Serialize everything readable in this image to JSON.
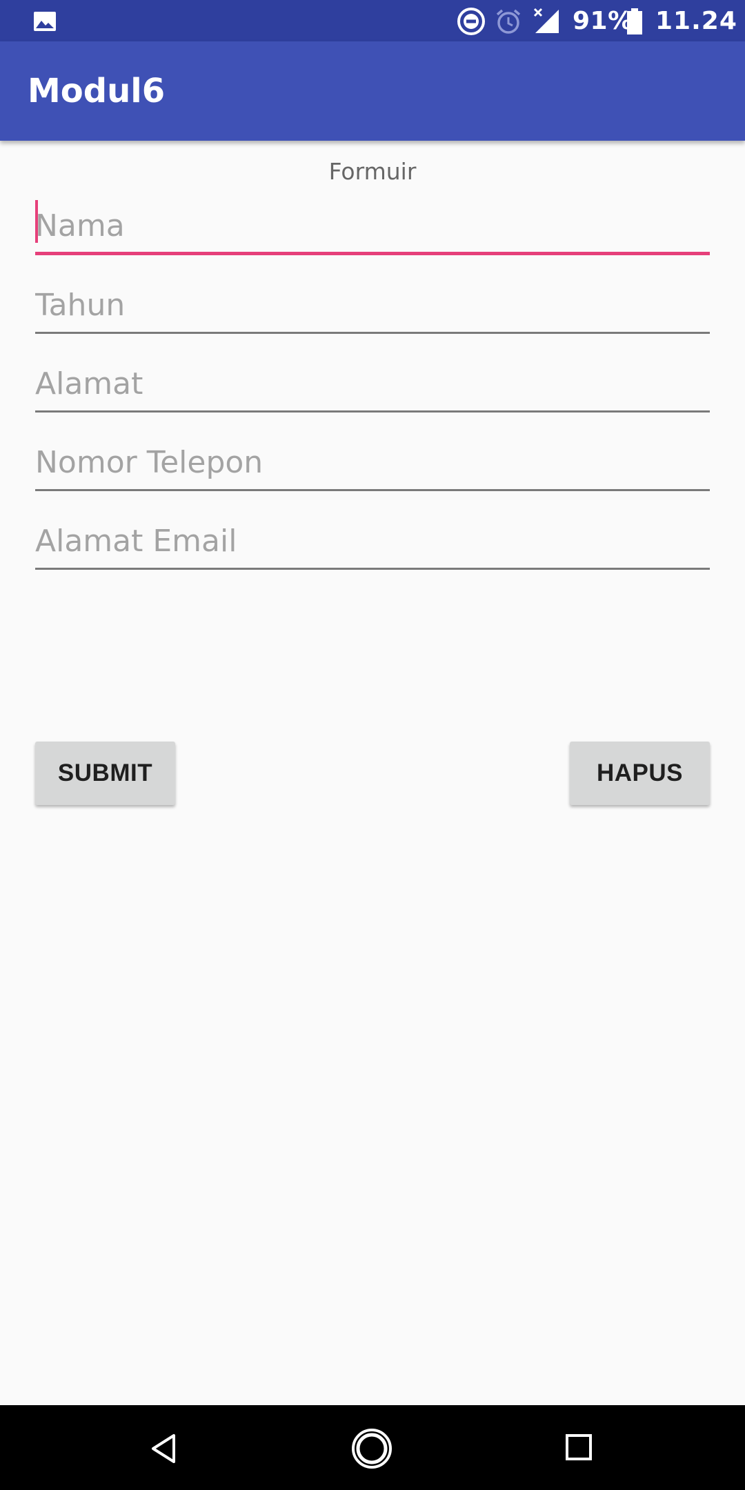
{
  "status_bar": {
    "battery_percent": "91%",
    "time": "11.24",
    "icons": [
      "image-icon",
      "do-not-disturb-icon",
      "alarm-icon",
      "no-signal-icon",
      "battery-icon"
    ]
  },
  "app_bar": {
    "title": "Modul6",
    "color": "#3f51b5"
  },
  "form": {
    "heading": "Formuir",
    "fields": [
      {
        "placeholder": "Nama",
        "value": "",
        "focused": true
      },
      {
        "placeholder": "Tahun",
        "value": ""
      },
      {
        "placeholder": "Alamat",
        "value": ""
      },
      {
        "placeholder": "Nomor Telepon",
        "value": ""
      },
      {
        "placeholder": "Alamat Email",
        "value": ""
      }
    ],
    "accent_color": "#e6407a"
  },
  "buttons": {
    "submit_label": "SUBMIT",
    "hapus_label": "HAPUS"
  },
  "nav_bar": {
    "icons": [
      "back-icon",
      "home-icon",
      "recents-icon"
    ]
  }
}
